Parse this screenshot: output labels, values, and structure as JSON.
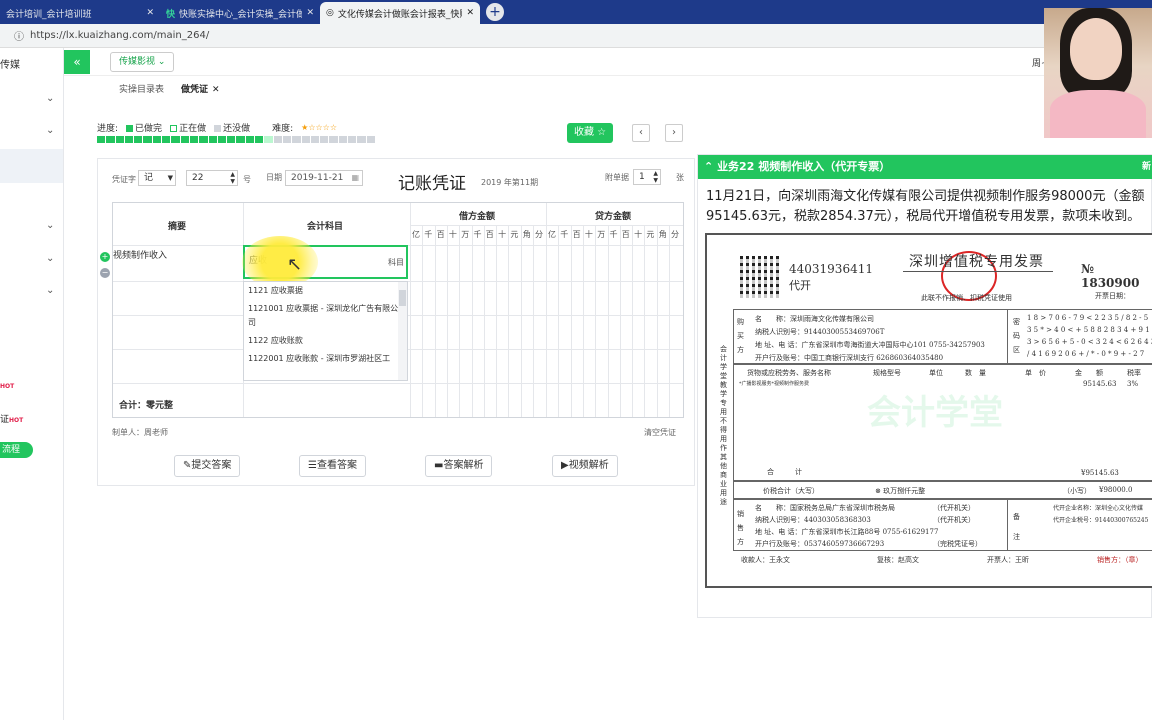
{
  "browser": {
    "tabs": [
      {
        "label": "会计培训_会计培训班",
        "active": false
      },
      {
        "label": "快账实操中心_会计实操_会计做",
        "active": false
      },
      {
        "label": "文化传媒会计做账会计报表_快账",
        "active": true
      }
    ],
    "url": "https://lx.kuaizhang.com/main_264/"
  },
  "sidebar": {
    "brand": "传媒",
    "hot_items": [
      "证"
    ],
    "hot_badge": "HOT",
    "flow_button": "流程"
  },
  "topnav": {
    "module_dropdown": "传媒影视",
    "right_text": "周~"
  },
  "page_tabs": {
    "items": [
      "实操目录表",
      "做凭证"
    ],
    "active_index": 1
  },
  "progress": {
    "label": "进度:",
    "legend": [
      "已做完",
      "正在做",
      "还没做"
    ],
    "difficulty_label": "难度:",
    "difficulty_level": 1,
    "difficulty_max": 5,
    "segments_done": 18,
    "segments_total": 30,
    "colors": {
      "done": "#22c55e",
      "current": "#bbf7d0",
      "todo": "#d1d5db"
    }
  },
  "actions": {
    "collect": "收藏 ☆",
    "prev": "‹",
    "next": "›"
  },
  "voucher": {
    "word_label": "凭证字",
    "word_value": "记",
    "number_value": "22",
    "number_unit": "号",
    "date_label": "日期",
    "date_value": "2019-11-21",
    "title": "记账凭证",
    "period": "2019 年第11期",
    "attach_label": "附单据",
    "attach_value": "1",
    "attach_unit": "张",
    "col_summary": "摘要",
    "col_subject": "会计科目",
    "col_debit": "借方金额",
    "col_credit": "贷方金额",
    "digits": [
      "亿",
      "千",
      "百",
      "十",
      "万",
      "千",
      "百",
      "十",
      "元",
      "角",
      "分"
    ],
    "row1_summary": "视频制作收入",
    "subject_input": "应收",
    "subject_suffix": "科目",
    "dropdown": [
      "1121 应收票据",
      "1121001 应收票据 - 深圳龙化广告有限公司",
      "1122 应收账款",
      "1122001 应收账款 - 深圳市罗湖社区工"
    ],
    "total_label": "合计：零元整",
    "maker_label": "制单人：周老师",
    "clear_label": "清空凭证",
    "buttons": [
      "提交答案",
      "查看答案",
      "答案解析",
      "视频解析"
    ]
  },
  "panel": {
    "header": "业务22 视频制作收入（代开专票）",
    "header_right": "新",
    "description": "11月21日，向深圳雨海文化传媒有限公司提供视频制作服务98000元（金额95145.63元，税款2854.37元），税局代开增值税专用发票，款项未收到。"
  },
  "invoice": {
    "code": "44031936411",
    "daikai": "代开",
    "title": "深圳增值税专用发票",
    "no_prefix": "№",
    "no": "1830900",
    "watermark": "会计学堂",
    "note": "此联不作报销、扣税凭证使用",
    "issue_date_label": "开票日期：",
    "buyer_name_label": "名　　称：",
    "buyer_name": "深圳雨海文化传媒有限公司",
    "buyer_tax_label": "纳税人识别号：",
    "buyer_tax": "91440300553469706T",
    "buyer_addr_label": "地 址、电 话：",
    "buyer_addr": "广东省深圳市粤海街道大冲国际中心101 0755-34257903",
    "buyer_bank_label": "开户行及账号：",
    "buyer_bank": "中国工商银行深圳支行 626860364035480",
    "cipher": [
      "1 8 > 7 0 6 - 7 9 < 2 2 3 5 / 8 2 - 5",
      "3 5 * > 4 0 < + 5 8 8 2 8 3 4 + 9 1 2",
      "3 > 6 5 6 + 5 - 0 < 3 2 4 < 6 2 6 4 3",
      "/ 4 1 6 9 2 0 6 + / * - 0 * 9 + - 2 7"
    ],
    "col_goods": "货物或应税劳务、服务名称",
    "col_spec": "规格型号",
    "col_unit": "单位",
    "col_qty": "数　量",
    "col_price": "单　价",
    "col_amount": "金　　额",
    "col_rate": "税率",
    "item_name": "*广播影视服务*视频制作服务费",
    "item_amount": "95145.63",
    "item_rate": "3%",
    "subtotal_label": "合　　　计",
    "subtotal": "¥95145.63",
    "total_words_label": "价税合计（大写）",
    "total_words": "⊗ 玖万捌仟元整",
    "total_small_label": "（小写）",
    "total_small": "¥98000.0",
    "seller_name": "国家税务总局广东省深圳市税务局",
    "seller_tax": "440303058368303",
    "seller_addr": "广东省深圳市长江路88号 0755-61629177",
    "seller_bank": "053746059736667293",
    "seller_agent": "（代开机关）",
    "seller_agent2": "（代开机关）",
    "seller_agent3": "（完税凭证号）",
    "remark_label": "备注",
    "remark_right1": "代开企业名称：深圳全心文化传媒",
    "remark_right2": "代开企业税号：91440300765245",
    "payee": "收款人：王永文",
    "checker": "复核：赵高文",
    "drawer": "开票人：王昕",
    "seller_sign": "销售方：（章）",
    "side_text": "会计学堂教学专用 不得用作其他商业用途",
    "buyer_side": "购买方",
    "seller_side": "销售方",
    "cipher_side": "密码区"
  }
}
